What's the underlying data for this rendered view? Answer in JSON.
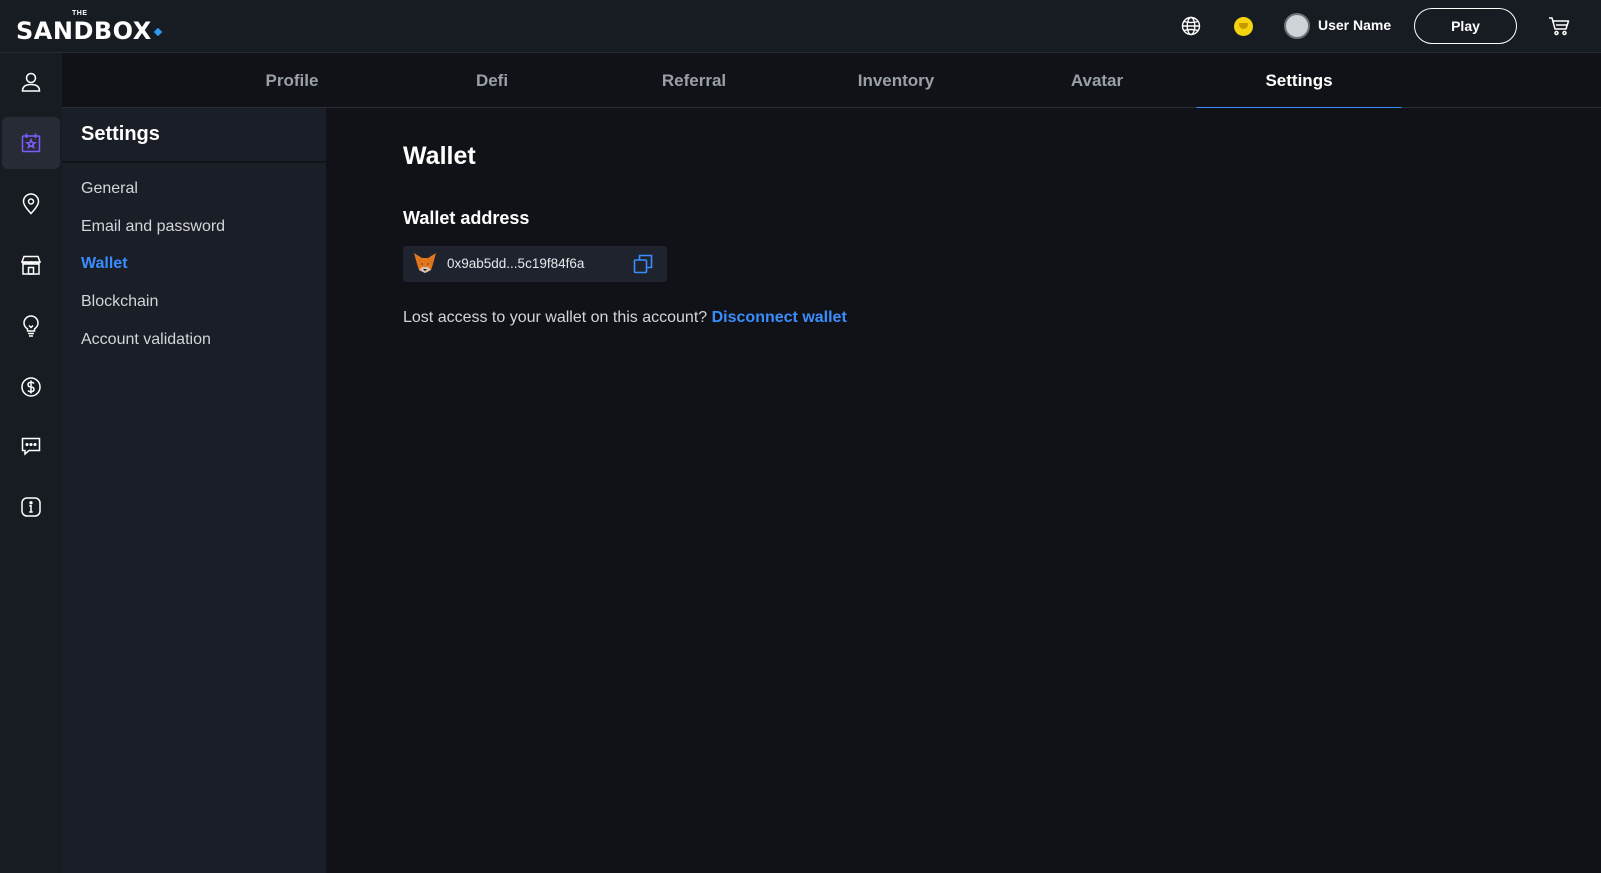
{
  "brand": {
    "logo_the": "THE",
    "logo_main": "SANDBOX"
  },
  "header": {
    "username": "User Name",
    "play_label": "Play"
  },
  "icons": {
    "globe": "globe-icon",
    "coin": "sand-coin-icon",
    "cart": "cart-icon"
  },
  "rail": [
    {
      "name": "profile-icon",
      "active": false
    },
    {
      "name": "events-icon",
      "active": true
    },
    {
      "name": "map-pin-icon",
      "active": false
    },
    {
      "name": "shop-icon",
      "active": false
    },
    {
      "name": "lightbulb-icon",
      "active": false
    },
    {
      "name": "dollar-icon",
      "active": false
    },
    {
      "name": "chat-icon",
      "active": false
    },
    {
      "name": "info-icon",
      "active": false
    }
  ],
  "tabs": [
    {
      "label": "Profile",
      "active": false
    },
    {
      "label": "Defi",
      "active": false
    },
    {
      "label": "Referral",
      "active": false
    },
    {
      "label": "Inventory",
      "active": false
    },
    {
      "label": "Avatar",
      "active": false
    },
    {
      "label": "Settings",
      "active": true
    }
  ],
  "settings": {
    "title": "Settings",
    "items": [
      {
        "label": "General",
        "active": false
      },
      {
        "label": "Email and password",
        "active": false
      },
      {
        "label": "Wallet",
        "active": true
      },
      {
        "label": "Blockchain",
        "active": false
      },
      {
        "label": "Account validation",
        "active": false
      }
    ]
  },
  "wallet": {
    "title": "Wallet",
    "address_label": "Wallet address",
    "address": "0x9ab5dd...5c19f84f6a",
    "lost_text": "Lost access to your wallet on this account?",
    "disconnect_label": "Disconnect wallet"
  },
  "colors": {
    "accent": "#3a8dff",
    "rail_active": "#5b3fd6",
    "coin": "#f5d40f"
  }
}
